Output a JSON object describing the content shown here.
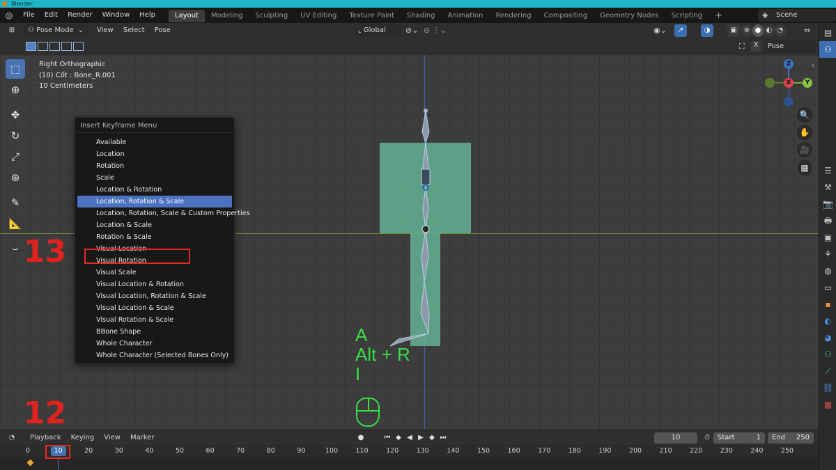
{
  "os": {
    "title": "Blender"
  },
  "menubar": {
    "items": [
      "File",
      "Edit",
      "Render",
      "Window",
      "Help"
    ]
  },
  "workspaces": [
    "Layout",
    "Modeling",
    "Sculpting",
    "UV Editing",
    "Texture Paint",
    "Shading",
    "Animation",
    "Rendering",
    "Compositing",
    "Geometry Nodes",
    "Scripting"
  ],
  "workspace_add": "+",
  "scene": {
    "label": "Scene"
  },
  "viewport_header": {
    "mode": "Pose Mode",
    "menus": [
      "View",
      "Select",
      "Pose"
    ],
    "orientation": "Global",
    "pose_options": "Pose Options"
  },
  "viewport_info": {
    "view": "Right Orthographic",
    "object": "(10) Cốt : Bone_R.001",
    "scale": "10 Centimeters"
  },
  "gizmo": {
    "z": "Z",
    "y": "Y",
    "x": "X"
  },
  "insert_keyframe_menu": {
    "title": "Insert Keyframe Menu",
    "items": [
      "Available",
      "Location",
      "Rotation",
      "Scale",
      "Location & Rotation",
      "Location, Rotation & Scale",
      "Location, Rotation, Scale & Custom Properties",
      "Location & Scale",
      "Rotation & Scale",
      "Visual Location",
      "Visual Rotation",
      "Visual Scale",
      "Visual Location & Rotation",
      "Visual Location, Rotation & Scale",
      "Visual Location & Scale",
      "Visual Rotation & Scale",
      "BBone Shape",
      "Whole Character",
      "Whole Character (Selected Bones Only)"
    ],
    "highlighted_index": 5
  },
  "annotations": {
    "step_13": "13",
    "step_12": "12",
    "keys": [
      "A",
      "Alt + R",
      "I"
    ]
  },
  "timeline": {
    "menus": [
      "Playback",
      "Keying",
      "View",
      "Marker"
    ],
    "current_frame": "10",
    "start_label": "Start",
    "start_value": "1",
    "end_label": "End",
    "end_value": "250",
    "ruler": [
      "0",
      "10",
      "20",
      "30",
      "40",
      "50",
      "60",
      "70",
      "80",
      "90",
      "100",
      "110",
      "120",
      "130",
      "140",
      "150",
      "160",
      "170",
      "180",
      "190",
      "200",
      "210",
      "220",
      "230",
      "240",
      "250"
    ]
  },
  "colors": {
    "accent": "#4a72c0",
    "annotation_red": "#e52a22",
    "annotation_green": "#38e046",
    "mesh": "#64b294"
  }
}
